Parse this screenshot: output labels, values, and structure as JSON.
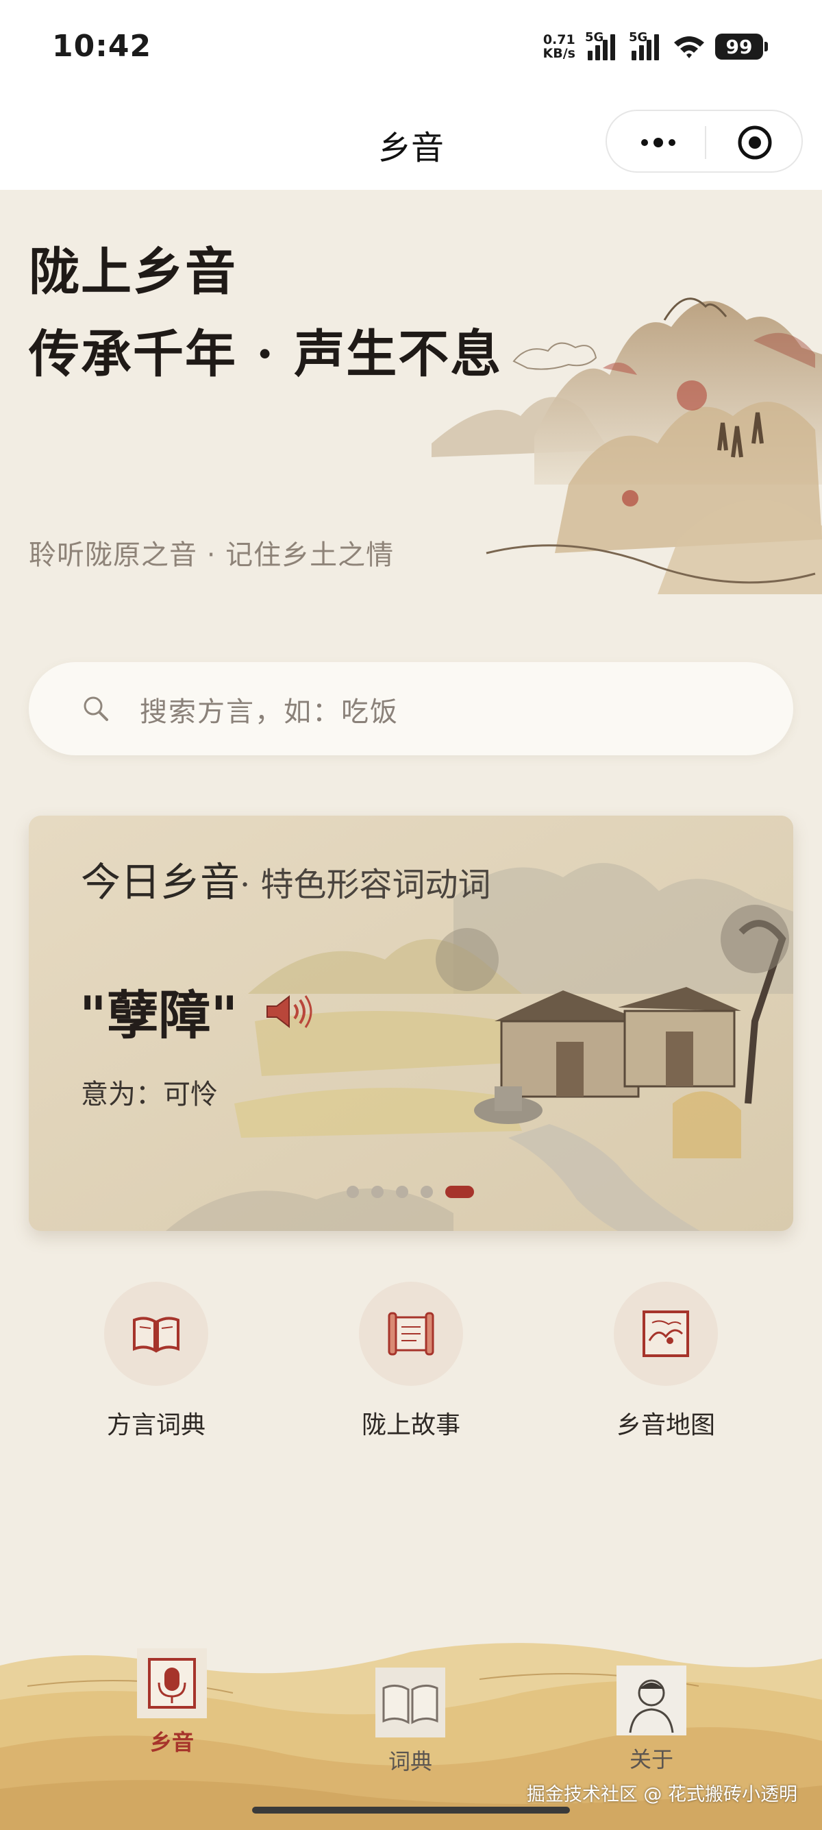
{
  "status": {
    "time": "10:42",
    "net_speed_value": "0.71",
    "net_speed_unit": "KB/s",
    "sim1": "5G",
    "sim2": "5G",
    "battery": "99"
  },
  "nav": {
    "title": "乡音"
  },
  "hero": {
    "line1": "陇上乡音",
    "line2": "传承千年 · 声生不息",
    "subtitle": "聆听陇原之音 · 记住乡土之情"
  },
  "search": {
    "placeholder": "搜索方言，如：吃饭"
  },
  "daily": {
    "heading": "今日乡音",
    "subheading": "· 特色形容词动词",
    "word": "\"孽障\"",
    "meaning": "意为：可怜",
    "carousel_total": 5,
    "carousel_active": 5
  },
  "features": [
    {
      "label": "方言词典",
      "icon": "book-icon"
    },
    {
      "label": "陇上故事",
      "icon": "scroll-icon"
    },
    {
      "label": "乡音地图",
      "icon": "map-icon"
    }
  ],
  "tabs": [
    {
      "label": "乡音",
      "icon": "microphone-icon",
      "active": true
    },
    {
      "label": "词典",
      "icon": "book-icon",
      "active": false
    },
    {
      "label": "关于",
      "icon": "avatar-portrait-icon",
      "active": false
    }
  ],
  "colors": {
    "accent": "#a6342b",
    "background": "#f2ede3",
    "muted_text": "#8e8378"
  },
  "watermark": "掘金技术社区 @ 花式搬砖小透明"
}
